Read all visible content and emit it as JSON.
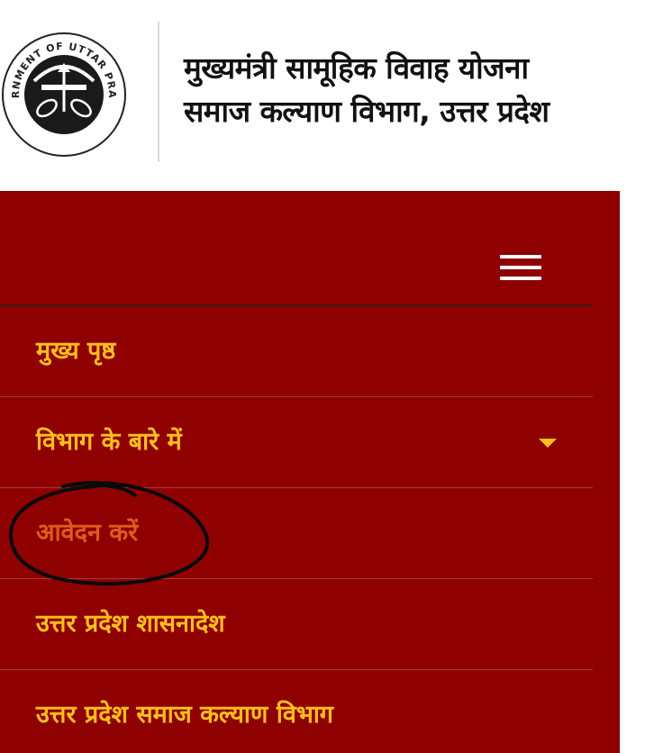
{
  "header": {
    "emblem_text": "GOVERNMENT OF UTTAR PRADESH",
    "title_line1": "मुख्यमंत्री सामूहिक विवाह योजना",
    "title_line2": "समाज कल्याण विभाग, उत्तर प्रदेश"
  },
  "nav": {
    "toggle_icon": "hamburger-menu-icon",
    "items": [
      {
        "label": "मुख्य पृष्ठ"
      },
      {
        "label": "विभाग के बारे में",
        "has_dropdown": true
      },
      {
        "label": "आवेदन करें",
        "active": true
      },
      {
        "label": "उत्तर प्रदेश शासनादेश"
      },
      {
        "label": "उत्तर प्रदेश समाज कल्याण विभाग"
      }
    ]
  },
  "colors": {
    "menu_background": "#8f0000",
    "menu_text": "#ffbf1f",
    "active_text": "#e05a1f",
    "header_background": "#ffffff"
  }
}
